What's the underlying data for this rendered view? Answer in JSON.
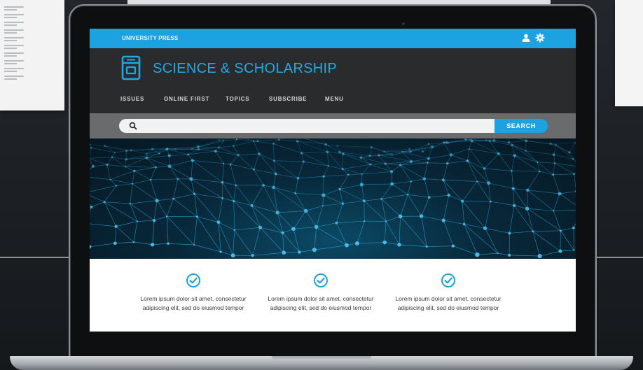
{
  "site": {
    "publisher": "UNIVERSITY PRESS",
    "title": "SCIENCE & SCHOLARSHIP"
  },
  "nav": {
    "items": [
      "ISSUES",
      "ONLINE FIRST",
      "TOPICS",
      "SUBSCRIBE",
      "MENU"
    ]
  },
  "search": {
    "placeholder": "",
    "button_label": "SEARCH"
  },
  "features": [
    {
      "text": "Lorem ipsum dolor sit amet, consectetur adipiscing elit, sed do eiusmod tempor"
    },
    {
      "text": "Lorem ipsum dolor sit amet, consectetur adipiscing elit, sed do eiusmod tempor"
    },
    {
      "text": "Lorem ipsum dolor sit amet, consectetur adipiscing elit, sed do eiusmod tempor"
    }
  ],
  "icons": {
    "logo": "book-icon",
    "user": "user-icon",
    "settings": "gear-icon",
    "search": "search-icon",
    "feature": "check-circle-icon"
  },
  "colors": {
    "accent": "#1da1e0",
    "header_bg": "#2a2b2d",
    "search_band": "#6a6b6d",
    "hero_dark": "#061722"
  }
}
